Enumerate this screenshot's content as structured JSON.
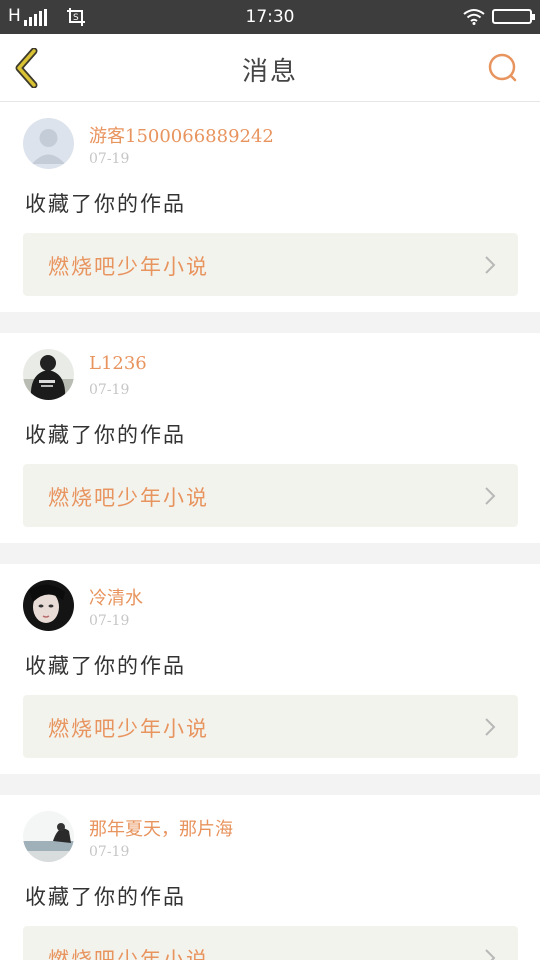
{
  "status_bar": {
    "carrier": "H",
    "time": "17:30"
  },
  "header": {
    "title": "消息",
    "back_icon": "chevron-left-icon",
    "search_icon": "search-icon"
  },
  "colors": {
    "accent": "#e8945e",
    "back_arrow": "#d9c233",
    "card_bg": "#f3f3ee",
    "divider": "#f3f3f3"
  },
  "messages": [
    {
      "user": "游客1500066889242",
      "date": "07-19",
      "text": "收藏了你的作品",
      "work": "燃烧吧少年小说",
      "avatar": "default-avatar-icon"
    },
    {
      "user": "L1236",
      "date": "07-19",
      "text": "收藏了你的作品",
      "work": "燃烧吧少年小说",
      "avatar": "hooded-figure-avatar"
    },
    {
      "user": "冷清水",
      "date": "07-19",
      "text": "收藏了你的作品",
      "work": "燃烧吧少年小说",
      "avatar": "girl-portrait-avatar"
    },
    {
      "user": "那年夏天，那片海",
      "date": "07-19",
      "text": "收藏了你的作品",
      "work": "燃烧吧少年小说",
      "avatar": "seaside-avatar"
    }
  ]
}
